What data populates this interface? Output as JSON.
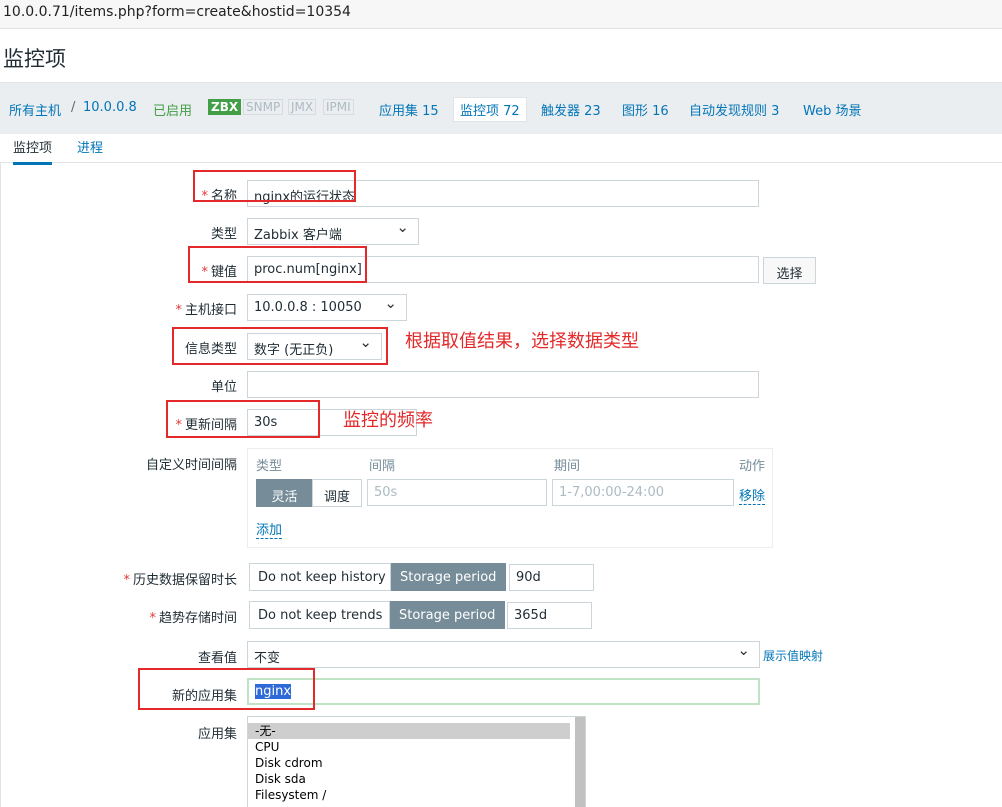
{
  "url": "10.0.0.71/items.php?form=create&hostid=10354",
  "page_title": "监控项",
  "breadcrumb": {
    "all_hosts": "所有主机",
    "separator": "/",
    "host": "10.0.0.8",
    "status": "已启用",
    "availability": [
      "ZBX",
      "SNMP",
      "JMX",
      "IPMI"
    ],
    "applications": "应用集 15",
    "items": "监控项 72",
    "triggers": "触发器 23",
    "graphs": "图形 16",
    "discovery": "自动发现规则 3",
    "web": "Web 场景"
  },
  "tabs": [
    "监控项",
    "进程"
  ],
  "form": {
    "name": {
      "label": "名称",
      "value": "nginx的运行状态"
    },
    "type": {
      "label": "类型",
      "value": "Zabbix 客户端"
    },
    "key": {
      "label": "键值",
      "value": "proc.num[nginx]",
      "button": "选择"
    },
    "interface": {
      "label": "主机接口",
      "value": "10.0.0.8 : 10050"
    },
    "info_type": {
      "label": "信息类型",
      "value": "数字 (无正负)"
    },
    "units": {
      "label": "单位",
      "value": ""
    },
    "update_interval": {
      "label": "更新间隔",
      "value": "30s"
    },
    "custom_intervals": {
      "label": "自定义时间间隔",
      "headers": {
        "type": "类型",
        "interval": "间隔",
        "period": "期间",
        "action": "动作"
      },
      "flexible": "灵活",
      "scheduling": "调度",
      "interval_placeholder": "50s",
      "period_placeholder": "1-7,00:00-24:00",
      "remove": "移除",
      "add": "添加"
    },
    "history": {
      "label": "历史数据保留时长",
      "option_off": "Do not keep history",
      "option_on": "Storage period",
      "value": "90d"
    },
    "trends": {
      "label": "趋势存储时间",
      "option_off": "Do not keep trends",
      "option_on": "Storage period",
      "value": "365d"
    },
    "show_value": {
      "label": "查看值",
      "value": "不变",
      "link": "展示值映射"
    },
    "new_application": {
      "label": "新的应用集",
      "value": "nginx"
    },
    "applications": {
      "label": "应用集",
      "options": [
        "-无-",
        "CPU",
        "Disk cdrom",
        "Disk sda",
        "Filesystem /"
      ]
    }
  },
  "annotations": {
    "info_type_note": "根据取值结果，选择数据类型",
    "interval_note": "监控的频率"
  },
  "colors": {
    "annotation": "#e3292a",
    "link": "#0275b8",
    "enabled": "#429e47",
    "segment_active": "#768d99"
  }
}
